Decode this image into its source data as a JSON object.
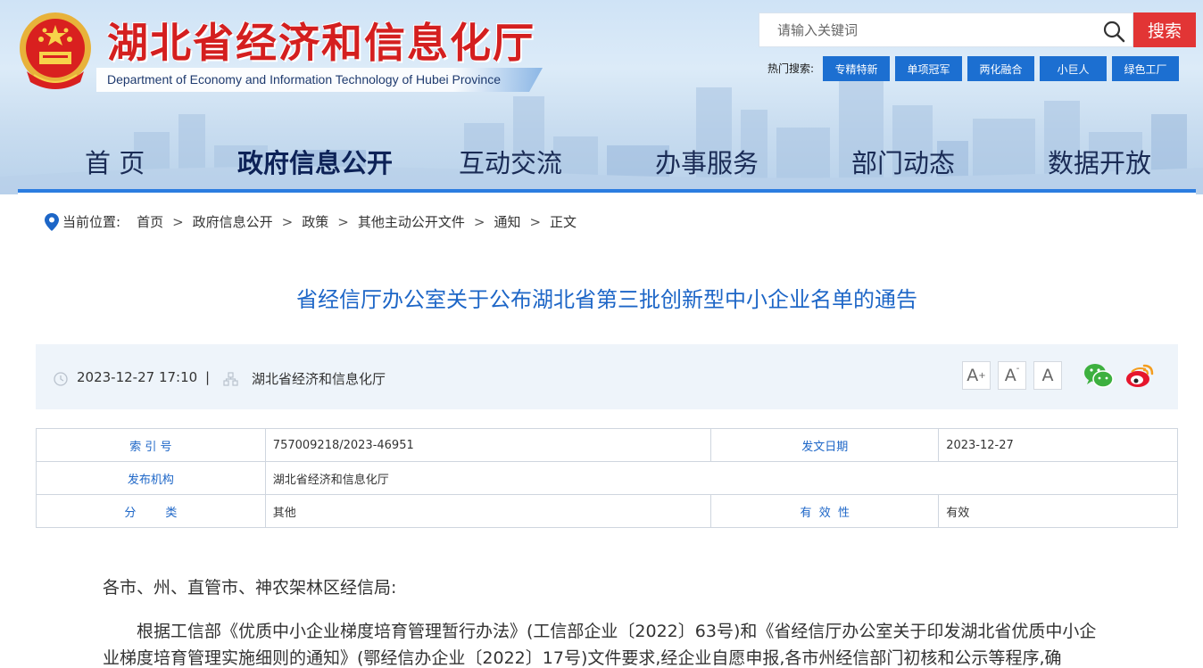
{
  "header": {
    "site_title": "湖北省经济和信息化厅",
    "site_subtitle": "Department of Economy and Information Technology of Hubei Province",
    "search_placeholder": "请输入关键词",
    "search_button": "搜索",
    "hot_label": "热门搜索:",
    "hot_tags": [
      "专精特新",
      "单项冠军",
      "两化融合",
      "小巨人",
      "绿色工厂"
    ],
    "brand_color": "#d41f1f",
    "accent_color": "#1c6fd1"
  },
  "nav": {
    "items": [
      "首 页",
      "政府信息公开",
      "互动交流",
      "办事服务",
      "部门动态",
      "数据开放"
    ],
    "active": "政府信息公开"
  },
  "breadcrumb": {
    "label": "当前位置:",
    "items": [
      "首页",
      "政府信息公开",
      "政策",
      "其他主动公开文件",
      "通知",
      "正文"
    ],
    "separator": ">"
  },
  "article": {
    "title": "省经信厅办公室关于公布湖北省第三批创新型中小企业名单的通告",
    "date": "2023-12-27 17:10",
    "divider": "|",
    "publisher": "湖北省经济和信息化厅",
    "font_buttons": [
      "A+",
      "A-",
      "A"
    ]
  },
  "info": {
    "index_label": "索  引  号",
    "index_value": "757009218/2023-46951",
    "date_label": "发文日期",
    "date_value": "2023-12-27",
    "org_label": "发布机构",
    "org_value": "湖北省经济和信息化厅",
    "category_label": "分        类",
    "category_value": "其他",
    "validity_label": "有  效  性",
    "validity_value": "有效"
  },
  "body": {
    "salutation": "各市、州、直管市、神农架林区经信局:",
    "line1": "根据工信部《优质中小企业梯度培育管理暂行办法》(工信部企业〔2022〕63号)和《省经信厅办公室关于印发湖北省优质中小企",
    "line2": "业梯度培育管理实施细则的通知》(鄂经信办企业〔2022〕17号)文件要求,经企业自愿申报,各市州经信部门初核和公示等程序,确"
  }
}
